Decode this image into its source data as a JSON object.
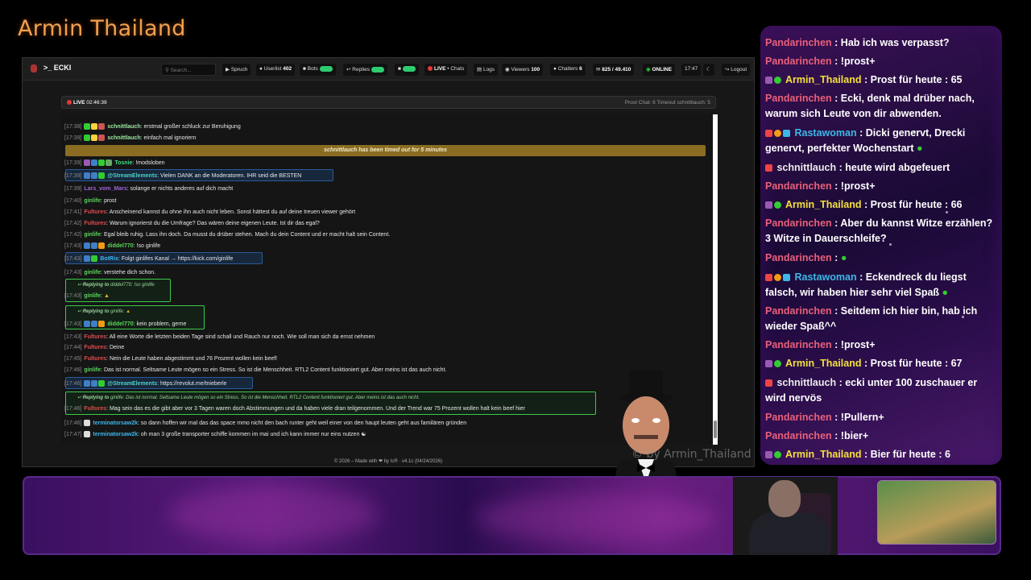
{
  "stream": {
    "title": "Armin Thailand",
    "watermark": "© by Armin_Thailand"
  },
  "toolbar": {
    "brand": "ECKI",
    "search_placeholder": "Search...",
    "sprach": "Spruch",
    "userlist": "Userlist",
    "userlist_count": "402",
    "bots": "Bots",
    "replies": "Replies",
    "live": "LIVE",
    "chats": "Chats",
    "logs": "Logs",
    "viewers": "Viewers",
    "viewers_count": "100",
    "chatters": "Chatters",
    "chatters_count": "6",
    "messages": "825 / 49.410",
    "status": "ONLINE",
    "time": "17:47",
    "logout": "Logout"
  },
  "livebar": {
    "label": "LIVE",
    "duration": "02:46:39",
    "right": "Prost Chat: 6  Timeout schnittlauch: 5"
  },
  "chat": {
    "messages": [
      {
        "ts": "[17:38]",
        "user": "schnittlauch",
        "color": "#9be79b",
        "text": "erstmal großer schluck zur Beruhigung"
      },
      {
        "ts": "[17:39]",
        "user": "schnittlauch",
        "color": "#9be79b",
        "text": "einfach mal ignoriern"
      },
      {
        "ts": "[17:39]",
        "user": "Tosnie",
        "color": "#3ddc84",
        "text": "!modsloben"
      },
      {
        "ts": "[17:39]",
        "user": "@StreamElements",
        "color": "#4fd1c5",
        "text": "Vielen DANK an die Moderatoren. IHR seid die BESTEN"
      },
      {
        "ts": "[17:39]",
        "user": "Lars_vom_Mars",
        "color": "#a064d8",
        "text": "solange er nichts anderes auf dich macht"
      },
      {
        "ts": "[17:40]",
        "user": "ginlife",
        "color": "#59d659",
        "text": "prost"
      },
      {
        "ts": "[17:41]",
        "user": "Fultures",
        "color": "#e34b4b",
        "text": "Anscheinend kannst du ohne ihn auch nicht leben. Sonst hättest du auf deine treuen viewer gehört"
      },
      {
        "ts": "[17:42]",
        "user": "Fultures",
        "color": "#e34b4b",
        "text": "Warum ignorierst du die Umfrage? Das wären deine eigenen Leute. Ist dir das egal?"
      },
      {
        "ts": "[17:42]",
        "user": "ginlife",
        "color": "#59d659",
        "text": "Egal bleib ruhig. Lass ihn doch. Da musst du drüber stehen. Mach du dein Content und er macht halt sein Content."
      },
      {
        "ts": "[17:43]",
        "user": "diddel770",
        "color": "#59d659",
        "text": "!so ginlife"
      },
      {
        "ts": "[17:43]",
        "user": "BotRix",
        "color": "#3fb6e8",
        "text": "Folgt ginlifes Kanal → https://kick.com/ginlife"
      },
      {
        "ts": "[17:43]",
        "user": "ginlife",
        "color": "#59d659",
        "text": "verstehe dich schon."
      },
      {
        "ts": "[17:43]",
        "user": "ginlife",
        "color": "#59d659",
        "text": ""
      },
      {
        "ts": "[17:43]",
        "user": "diddel770",
        "color": "#59d659",
        "text": "kein problem, gerne"
      },
      {
        "ts": "[17:43]",
        "user": "Fultures",
        "color": "#e34b4b",
        "text": "All eine Worte die letzten beiden Tage sind schall und Rauch nur noch. Wie soll man sich da ernst nehmen"
      },
      {
        "ts": "[17:44]",
        "user": "Fultures",
        "color": "#e34b4b",
        "text": "Deine"
      },
      {
        "ts": "[17:45]",
        "user": "Fultures",
        "color": "#e34b4b",
        "text": "Nein die Leute haben abgestimmt und 76 Prozent wollen kein beef!"
      },
      {
        "ts": "[17:46]",
        "user": "ginlife",
        "color": "#59d659",
        "text": "Das ist normal. Seltsame Leute mögen so ein Stress. So ist die Menschheit. RTL2 Content funktioniert gut. Aber meins ist das auch nicht."
      },
      {
        "ts": "[17:46]",
        "user": "@StreamElements",
        "color": "#4fd1c5",
        "text": "https://revolut.me/tnieberle"
      },
      {
        "ts": "[17:46]",
        "user": "Fultures",
        "color": "#e34b4b",
        "text": "Mag sein das es die gibt aber vor 3 Tagen waren doch Abstimmungen und da haben viele dran teilgenommen. Und der Trend war 75 Prozent wollen halt kein beef hier"
      },
      {
        "ts": "[17:46]",
        "user": "terminatorsaw2k",
        "color": "#3fb6e8",
        "text": "so dann hoffen wir mal das das space mmo nicht den bach runter geht weil einer von den haupt leuten geht aus familären gründen"
      },
      {
        "ts": "[17:47]",
        "user": "terminatorsaw2k",
        "color": "#3fb6e8",
        "text": "oh man 3 große transporter schiffe kommen im mai und ich kann immer nur eins nutzen"
      }
    ],
    "ban_notice": "schnittlauch has been timed out for 5 minutes",
    "replies": [
      {
        "label": "Replying to",
        "target": "diddel770:",
        "quote": "!so ginlife"
      },
      {
        "label": "Replying to",
        "target": "ginlife:",
        "quote": ""
      },
      {
        "label": "Replying to",
        "target": "ginlife:",
        "quote": "Das ist normal. Seltsame Leute mögen so ein Stress. So ist die Menschheit. RTL2 Content funktioniert gut. Aber meins ist das auch nicht."
      }
    ],
    "footer": "© 2026 – Made with ❤ by IcR · v4.1c (04/24/2026)"
  },
  "sidebar": {
    "messages": [
      {
        "user": "Pandarinchen",
        "cls": "pn",
        "text": ": Hab ich was verpasst?",
        "icons": 0
      },
      {
        "user": "Pandarinchen",
        "cls": "pn",
        "text": ": !prost+",
        "icons": 0
      },
      {
        "user": "Armin_Thailand",
        "cls": "at",
        "text": ": Prost für heute : 65",
        "icons": 2
      },
      {
        "user": "Pandarinchen",
        "cls": "pn",
        "text": ": Ecki, denk mal drüber nach, warum sich Leute von dir abwenden.",
        "icons": 0
      },
      {
        "user": "Rastawoman",
        "cls": "rw",
        "text": ": Dicki genervt, Drecki genervt, perfekter Wochenstart",
        "icons": 3
      },
      {
        "user": "schnittlauch",
        "cls": "sl",
        "text": ": heute wird abgefeuert",
        "icons": 1
      },
      {
        "user": "Pandarinchen",
        "cls": "pn",
        "text": ": !prost+",
        "icons": 0
      },
      {
        "user": "Armin_Thailand",
        "cls": "at",
        "text": ": Prost für heute : 66",
        "icons": 2
      },
      {
        "user": "Pandarinchen",
        "cls": "pn",
        "text": ": Aber du kannst Witze erzählen? 3 Witze in Dauerschleife?",
        "icons": 0
      },
      {
        "user": "Pandarinchen",
        "cls": "pn",
        "text": ":",
        "icons": 0
      },
      {
        "user": "Rastawoman",
        "cls": "rw",
        "text": ": Eckendreck du liegst falsch, wir haben hier sehr viel Spaß",
        "icons": 3
      },
      {
        "user": "Pandarinchen",
        "cls": "pn",
        "text": ": Seitdem ich hier bin, hab ich wieder Spaß^^",
        "icons": 0
      },
      {
        "user": "Pandarinchen",
        "cls": "pn",
        "text": ": !prost+",
        "icons": 0
      },
      {
        "user": "Armin_Thailand",
        "cls": "at",
        "text": ": Prost für heute : 67",
        "icons": 2
      },
      {
        "user": "schnittlauch",
        "cls": "sl",
        "text": ": ecki unter 100 zuschauer er wird nervös",
        "icons": 1
      },
      {
        "user": "Pandarinchen",
        "cls": "pn",
        "text": ": !Pullern+",
        "icons": 0
      },
      {
        "user": "Pandarinchen",
        "cls": "pn",
        "text": ": !bier+",
        "icons": 0
      },
      {
        "user": "Armin_Thailand",
        "cls": "at",
        "text": ": Bier für heute : 6",
        "icons": 2
      }
    ]
  },
  "colors": {
    "accent": "#f0a050",
    "panel": "#2a0d4a"
  }
}
